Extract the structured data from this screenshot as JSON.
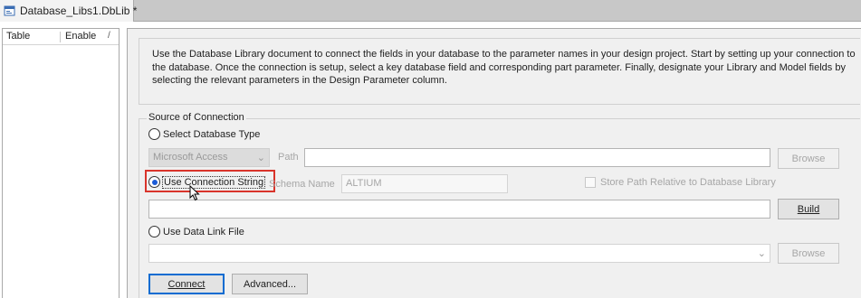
{
  "tab": {
    "title": "Database_Libs1.DbLib *",
    "icon": "database-library-icon"
  },
  "left_pane": {
    "columns": [
      "Table",
      "Enable"
    ],
    "sort_indicator": "/"
  },
  "info_text": "Use the Database Library document to connect the fields in your database to the parameter names in your design project. Start by setting up your connection to the database. Once the connection is setup, select a key database field and corresponding part parameter. Finally, designate your Library and Model fields by selecting the relevant parameters in the Design Parameter column.",
  "source": {
    "title": "Source of Connection",
    "select_db_type": {
      "label": "Select Database Type",
      "selected": false,
      "db_type_value": "Microsoft Access",
      "path_label": "Path",
      "path_value": "",
      "browse_label": "Browse"
    },
    "use_connection_string": {
      "label": "Use Connection String",
      "selected": true,
      "schema_label": "Schema Name",
      "schema_value": "ALTIUM",
      "store_path_label": "Store Path Relative to Database Library",
      "connection_value": "",
      "build_label": "Build"
    },
    "use_data_link": {
      "label": "Use Data Link File",
      "selected": false,
      "file_value": "",
      "browse_label": "Browse"
    }
  },
  "buttons": {
    "connect": "Connect",
    "advanced": "Advanced..."
  },
  "colors": {
    "highlight": "#d9342b",
    "primary_border": "#0a6cd1",
    "radio_dot": "#1a5bd6"
  }
}
